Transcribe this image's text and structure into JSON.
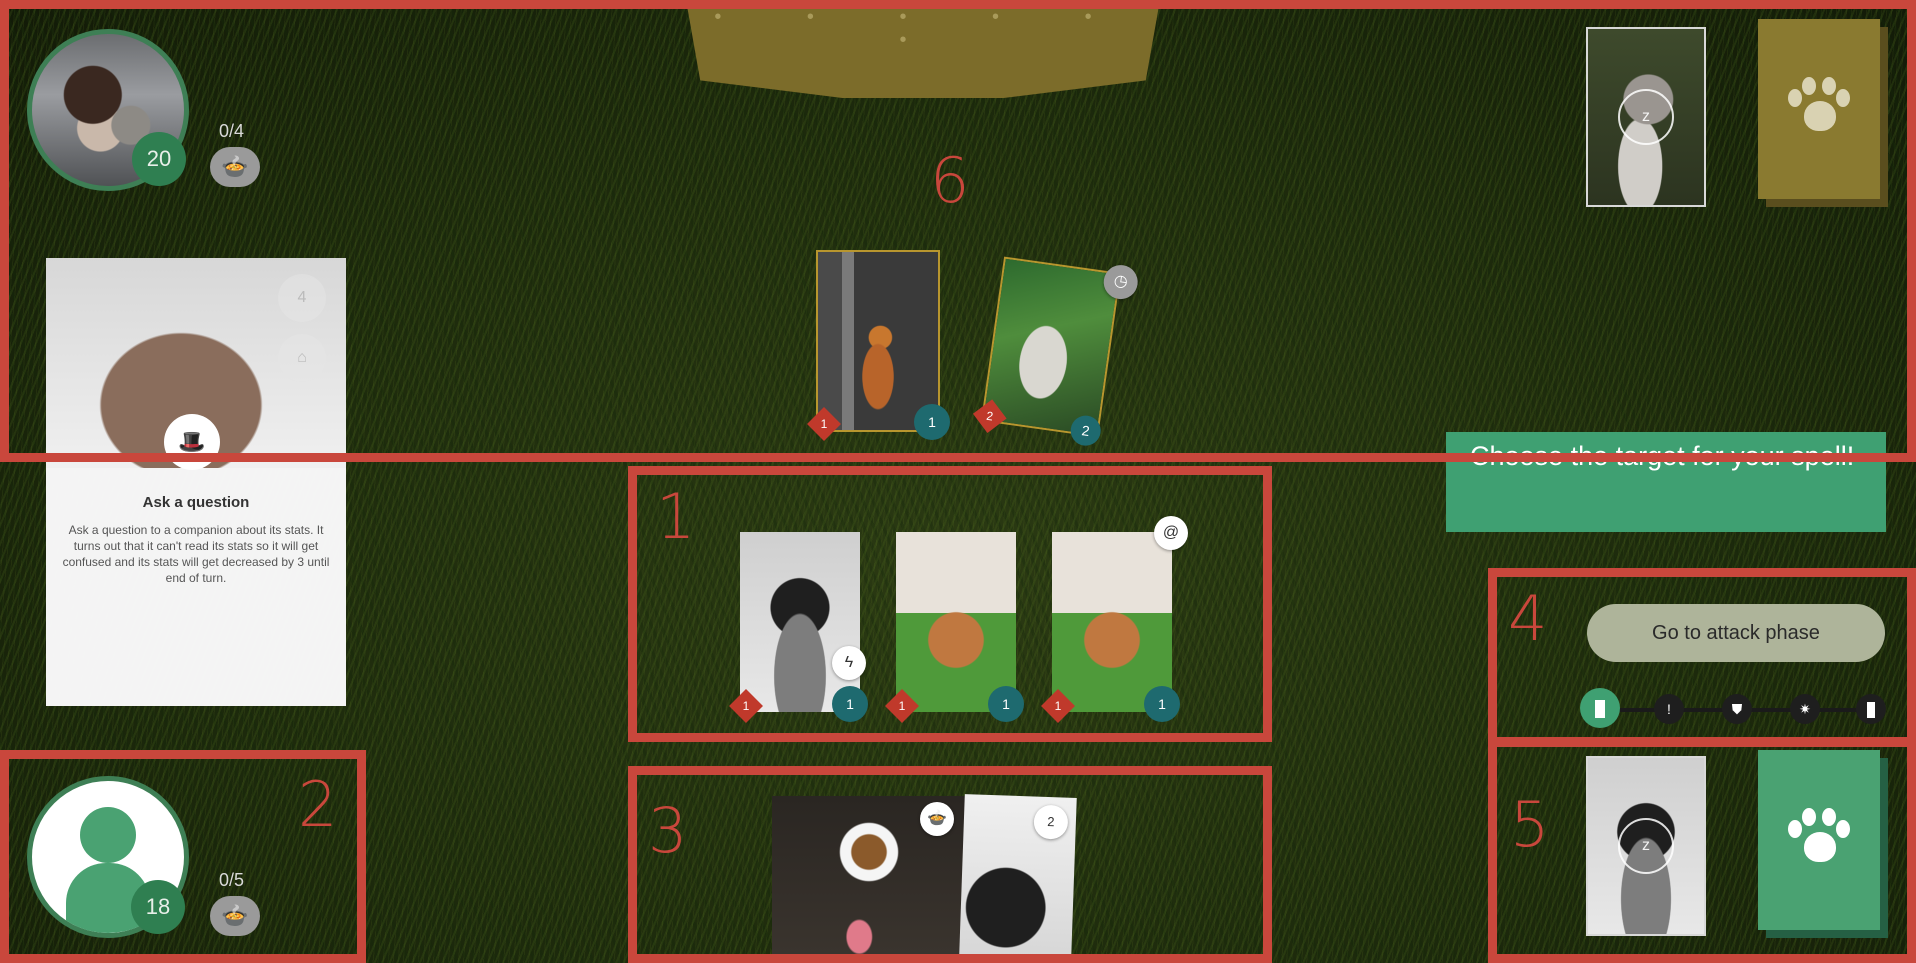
{
  "opponent": {
    "hp": "20",
    "food": "0/4",
    "food_icon": "food-bowl-icon"
  },
  "player": {
    "hp": "18",
    "food": "0/5",
    "food_icon": "food-bowl-icon"
  },
  "regions": {
    "r1": "1",
    "r2": "2",
    "r3": "3",
    "r4": "4",
    "r5": "5",
    "r6": "6"
  },
  "board_opponent": [
    {
      "attack": "1",
      "health": "1",
      "art": "orange-cat"
    },
    {
      "attack": "2",
      "health": "2",
      "art": "white-cat",
      "badge": "clock-icon"
    }
  ],
  "board_player": [
    {
      "attack": "1",
      "health": "1",
      "art": "pug",
      "badge": "lightning-icon"
    },
    {
      "attack": "1",
      "health": "1",
      "art": "poodle"
    },
    {
      "attack": "1",
      "health": "1",
      "art": "poodle",
      "badge": "spiral-icon"
    }
  ],
  "hand": [
    {
      "art": "dog-food",
      "badge": "food-bowl-icon"
    },
    {
      "art": "pug",
      "cost": "2"
    }
  ],
  "tooltip": {
    "title": "Ask a question",
    "description": "Ask a question to a companion about its stats. It turns out that it can't read its stats so it will get confused and its stats will get decreased by 3 until end of turn.",
    "cost": "4",
    "icon": "top-hat-icon"
  },
  "message": "Choose the target for your spell!",
  "phase_button": "Go to attack phase",
  "phases": [
    "start",
    "!",
    "shield",
    "burst",
    "end"
  ],
  "colors": {
    "accent_green": "#3fa072",
    "region_red": "#c9473c",
    "opponent_gold": "#7c6c2a",
    "stat_red": "#c0392b",
    "stat_teal": "#1e6a6f"
  }
}
